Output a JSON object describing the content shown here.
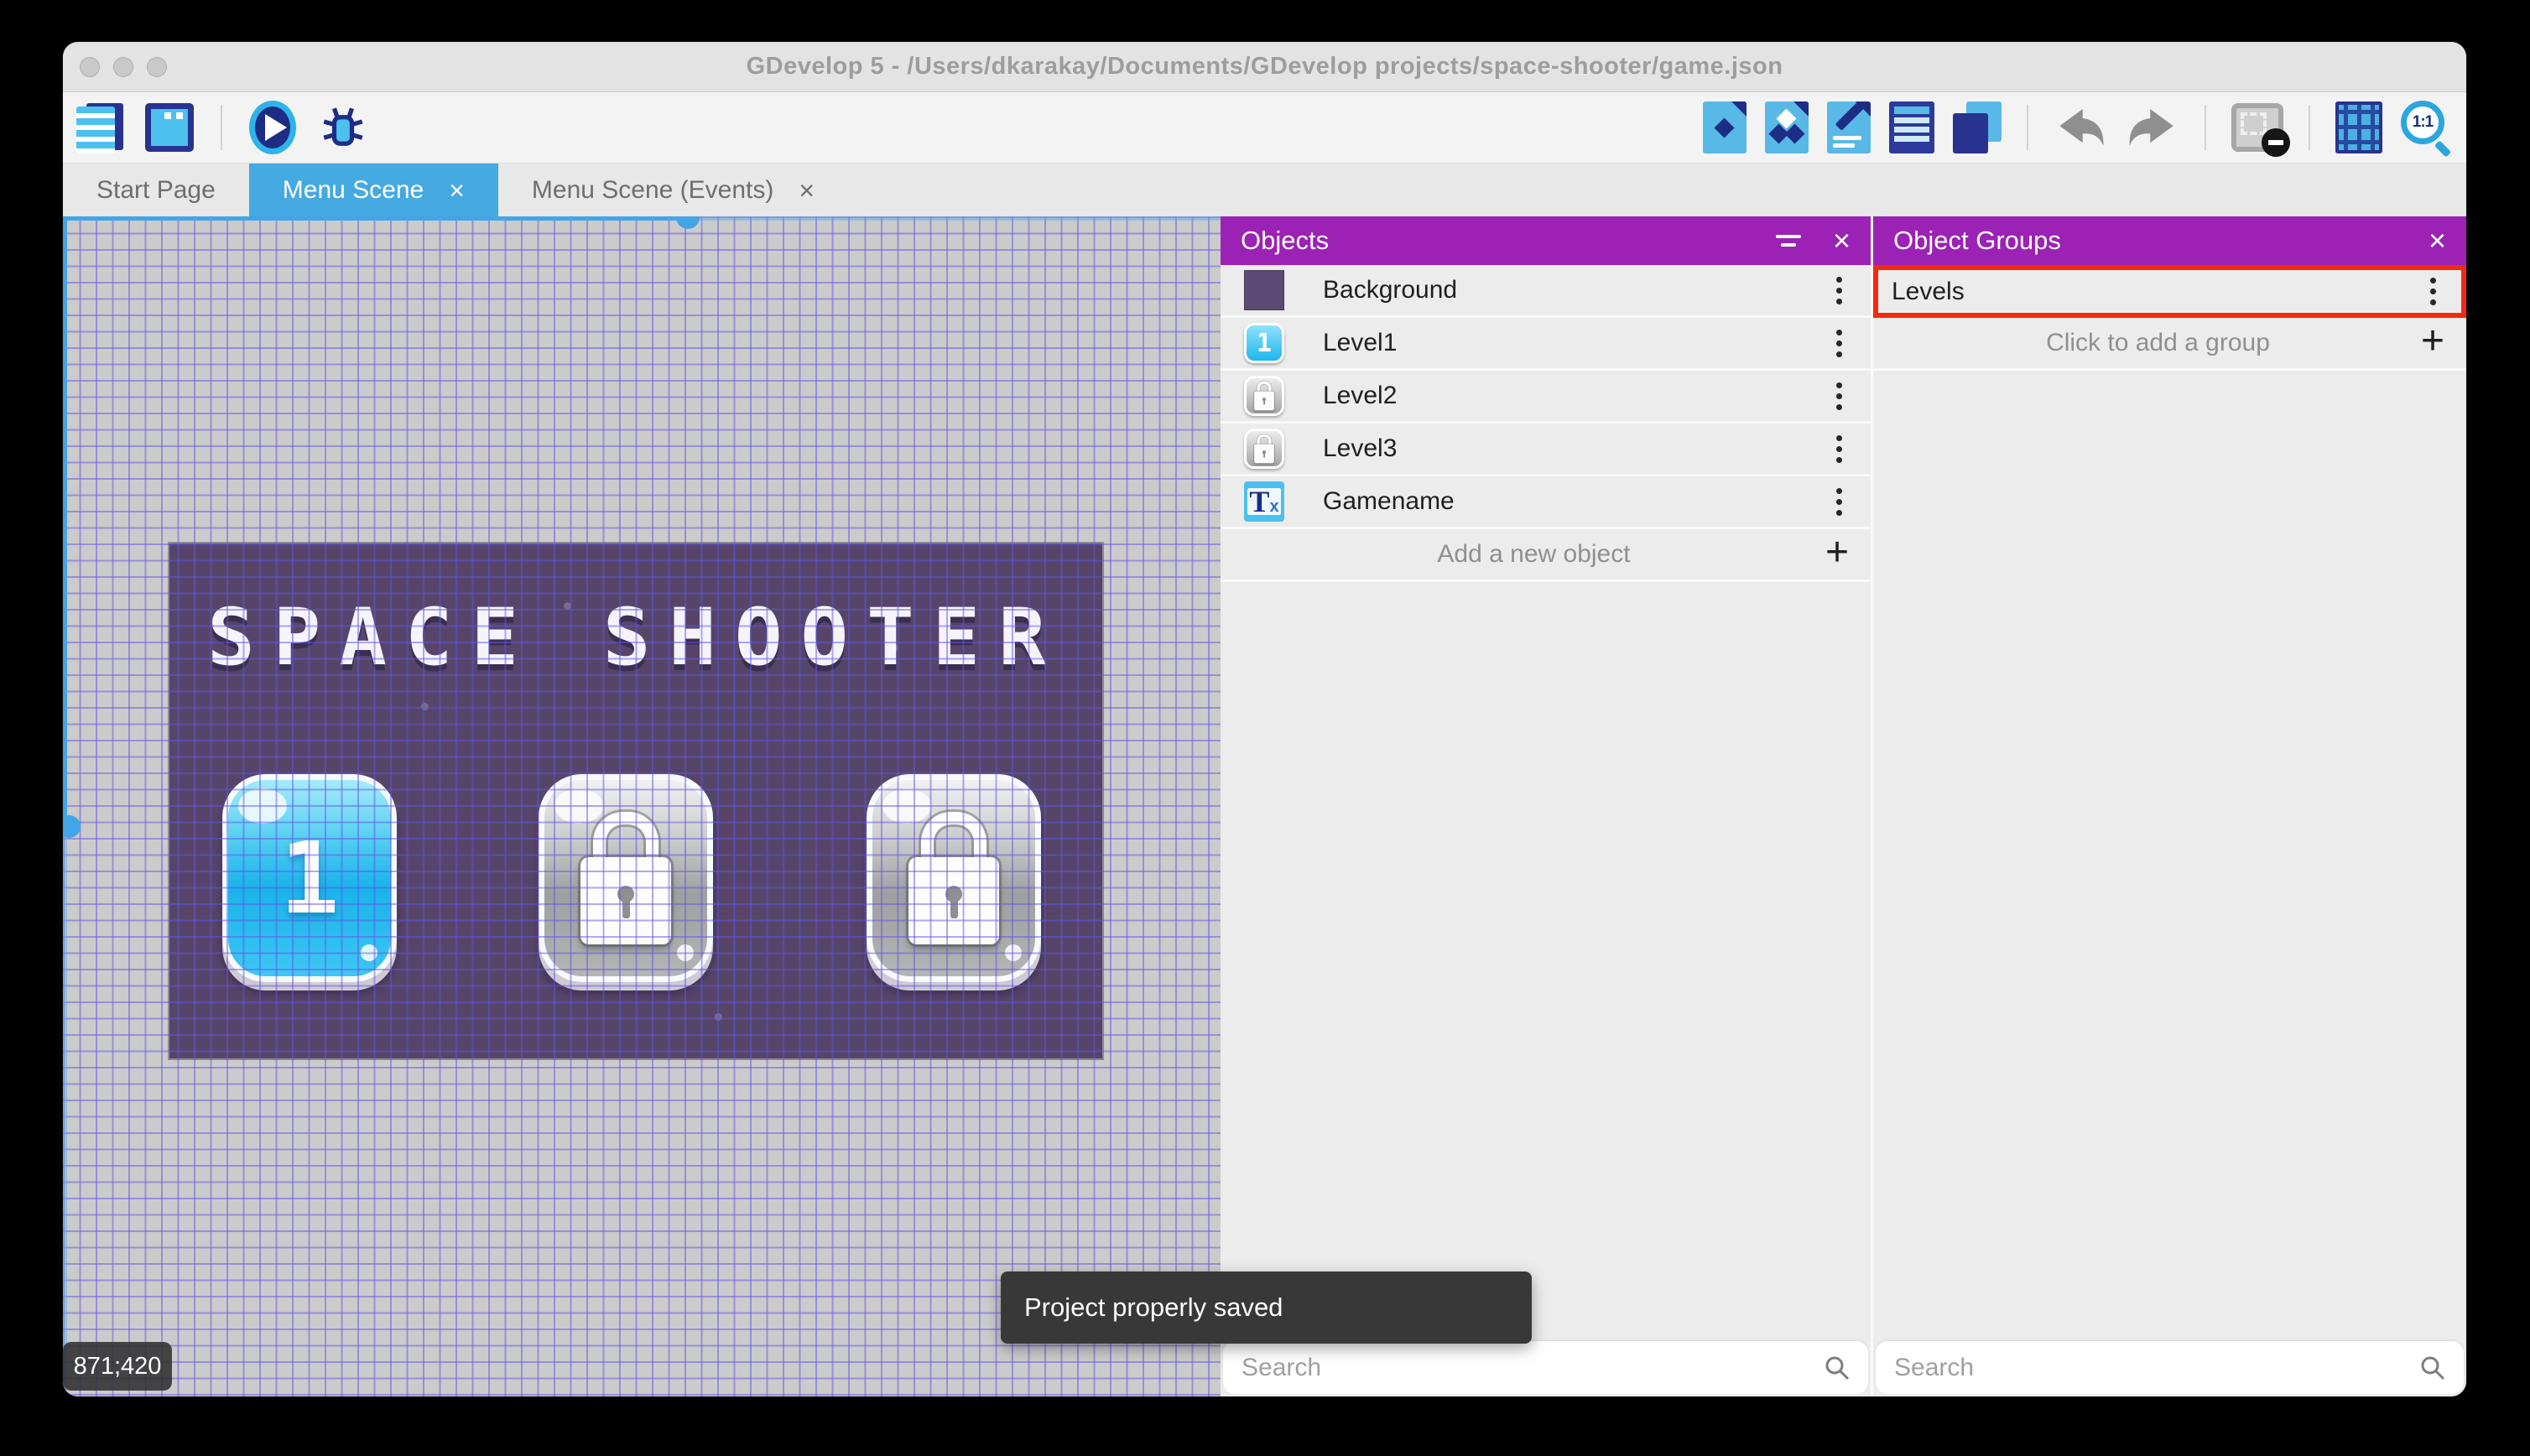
{
  "window": {
    "title": "GDevelop 5 - /Users/dkarakay/Documents/GDevelop projects/space-shooter/game.json"
  },
  "titlebar": {
    "traffic_lights": [
      "close",
      "minimize",
      "maximize"
    ]
  },
  "toolbar": {
    "left_icons": [
      "project-manager",
      "scene-window",
      "preview",
      "debug"
    ],
    "right_icons": [
      "objects-editor",
      "object-groups-editor",
      "properties",
      "instances-list",
      "layers",
      "undo",
      "redo",
      "mask-toggle",
      "grid-toggle",
      "zoom-reset"
    ],
    "zoom_label": "1:1"
  },
  "tabs": [
    {
      "label": "Start Page",
      "active": false,
      "closable": false
    },
    {
      "label": "Menu Scene",
      "active": true,
      "closable": true
    },
    {
      "label": "Menu Scene (Events)",
      "active": false,
      "closable": true
    }
  ],
  "canvas": {
    "coordinates": "871;420",
    "toast": "Project properly saved",
    "game": {
      "title": "SPACE SHOOTER",
      "buttons": [
        {
          "label": "1",
          "state": "unlocked"
        },
        {
          "state": "locked"
        },
        {
          "state": "locked"
        }
      ]
    }
  },
  "objects_panel": {
    "title": "Objects",
    "rows": [
      {
        "name": "Background",
        "thumb": "purple-square"
      },
      {
        "name": "Level1",
        "thumb": "blue-button",
        "thumb_label": "1"
      },
      {
        "name": "Level2",
        "thumb": "locked-button"
      },
      {
        "name": "Level3",
        "thumb": "locked-button"
      },
      {
        "name": "Gamename",
        "thumb": "text-object",
        "thumb_main": "T",
        "thumb_sub": "x"
      }
    ],
    "add_label": "Add a new object",
    "search_placeholder": "Search"
  },
  "groups_panel": {
    "title": "Object Groups",
    "rows": [
      {
        "name": "Levels",
        "highlighted": true
      }
    ],
    "add_label": "Click to add a group",
    "search_placeholder": "Search"
  },
  "colors": {
    "panel_header": "#9c22b5",
    "active_tab": "#45a9e2",
    "selection": "#42a5e5",
    "highlight_border": "#f42a0a",
    "game_background": "#574569",
    "toast_bg": "#383838"
  }
}
